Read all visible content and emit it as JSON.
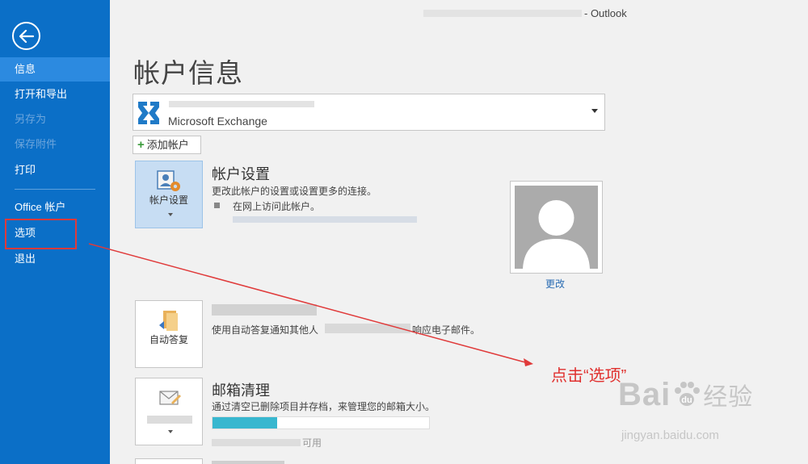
{
  "window": {
    "app_name": "- Outlook"
  },
  "sidebar": {
    "items": [
      {
        "label": "信息"
      },
      {
        "label": "打开和导出"
      },
      {
        "label": "另存为"
      },
      {
        "label": "保存附件"
      },
      {
        "label": "打印"
      },
      {
        "label": "Office 帐户"
      },
      {
        "label": "选项"
      },
      {
        "label": "退出"
      }
    ]
  },
  "main": {
    "title": "帐户信息",
    "account": {
      "type": "Microsoft Exchange"
    },
    "add_account_label": "添加帐户",
    "account_settings": {
      "tile_label": "帐户设置",
      "title": "帐户设置",
      "desc": "更改此帐户的设置或设置更多的连接。",
      "bullet": "在网上访问此帐户。"
    },
    "avatar": {
      "change_label": "更改"
    },
    "auto_reply": {
      "tile_label": "自动答复",
      "desc_start": "使用自动答复通知其他人",
      "desc_end": "响应电子邮件。"
    },
    "mailbox_cleanup": {
      "title": "邮箱清理",
      "desc": "通过清空已删除项目并存档，来管理您的邮箱大小。",
      "usage_fragment": "可用",
      "usage_fraction": 0.3
    }
  },
  "annotation": {
    "text": "点击“选项”"
  },
  "watermark": {
    "main": "Bai",
    "du": "du",
    "cn": "经验",
    "sub": "jingyan.baidu.com"
  },
  "colors": {
    "sidebar": "#0b6fc7",
    "highlight": "#e03a3a",
    "progress": "#38b7cf"
  }
}
